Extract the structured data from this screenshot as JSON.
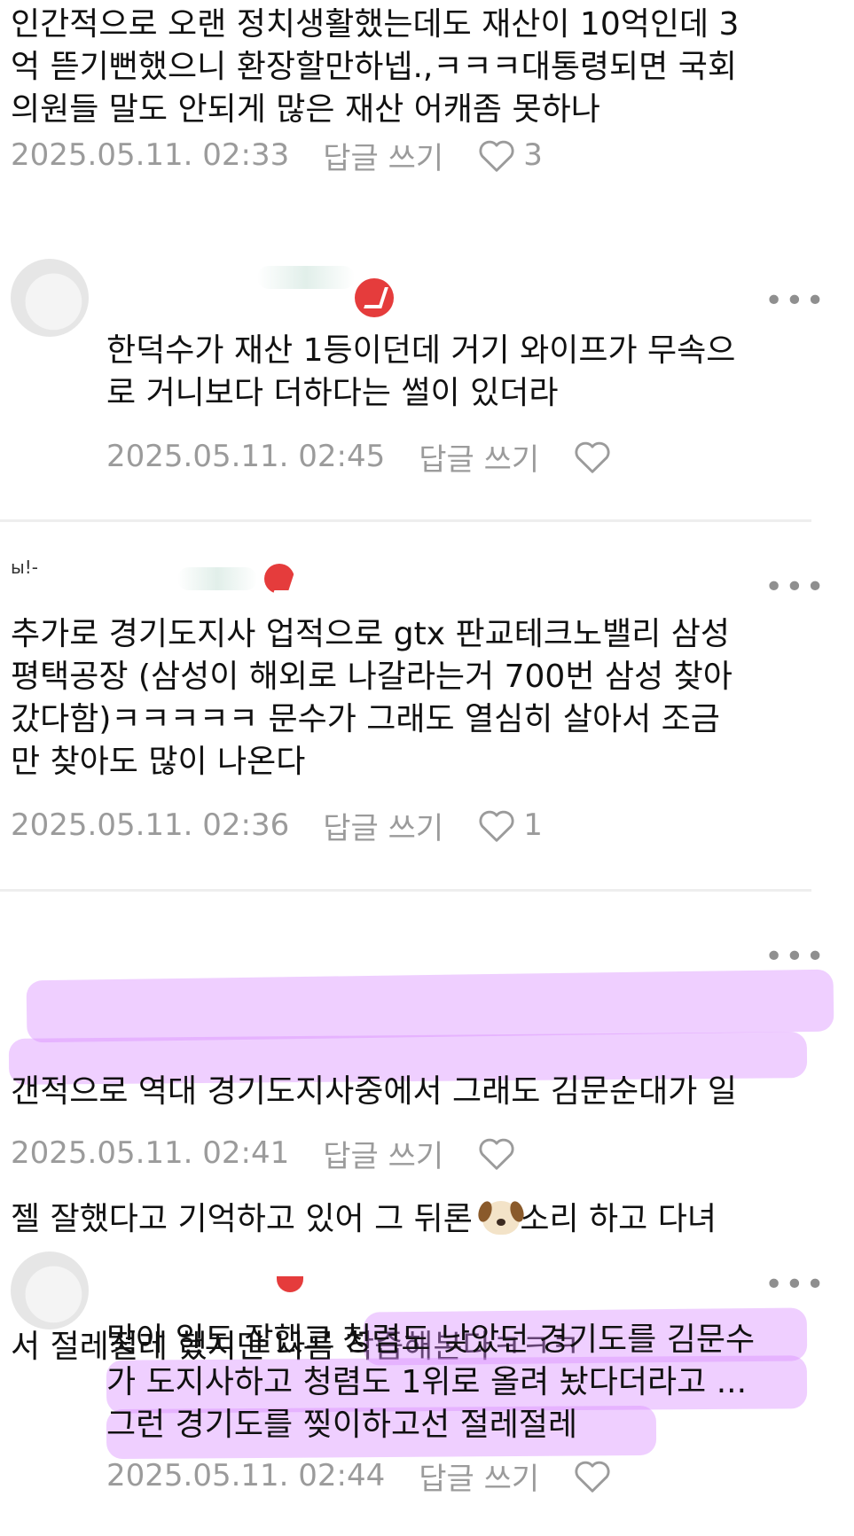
{
  "comments": [
    {
      "text": "인간적으로 오랜 정치생활했는데도 재산이 10억인데 3\n억 뜯기뻔했으니 환장할만하넵.,ㅋㅋㅋ대통령되면 국회\n의원들 말도 안되게 많은 재산 어캐좀 못하나",
      "date": "2025.05.11. 02:33",
      "reply_label": "답글 쓰기",
      "likes": "3"
    },
    {
      "text": "한덕수가 재산 1등이던데 거기 와이프가 무속으\n로 거니보다 더하다는 썰이 있더라",
      "date": "2025.05.11. 02:45",
      "reply_label": "답글 쓰기",
      "likes": ""
    },
    {
      "name_fragment": "ы!-",
      "text": "추가로 경기도지사 업적으로 gtx 판교테크노밸리 삼성\n평택공장 (삼성이 해외로 나갈라는거 700번 삼성 찾아\n갔다함)ㅋㅋㅋㅋㅋ 문수가 그래도 열심히 살아서 조금\n만 찾아도 많이 나온다",
      "date": "2025.05.11. 02:36",
      "reply_label": "답글 쓰기",
      "likes": "1"
    },
    {
      "line1": "갠적으로 역대 경기도지사중에서 그래도 김문순대가 일",
      "line2_before": "젤 잘했다고 기억하고 있어 그 뒤론 ",
      "line2_after": "소리 하고 다녀",
      "line3": "서 절레절레 했지만 나름 착즙해본다ㅋㅋㅋ",
      "date": "2025.05.11. 02:41",
      "reply_label": "답글 쓰기",
      "likes": ""
    },
    {
      "text": "맞아 일도 잘했고 청렴도 낮았던 경기도를 김문수\n가 도지사하고 청렴도 1위로 올려 놨다더라고 ...\n그런 경기도를 찢이하고선 절레절레",
      "date": "2025.05.11. 02:44",
      "reply_label": "답글 쓰기",
      "likes": ""
    }
  ],
  "more_label": "•••",
  "icons": {
    "heart": "heart-outline-icon",
    "more": "more-dots-icon",
    "dog": "dog-emoji"
  },
  "colors": {
    "highlight": "#da8cff",
    "meta": "#9b9b9b",
    "badge": "#e53c3c"
  }
}
